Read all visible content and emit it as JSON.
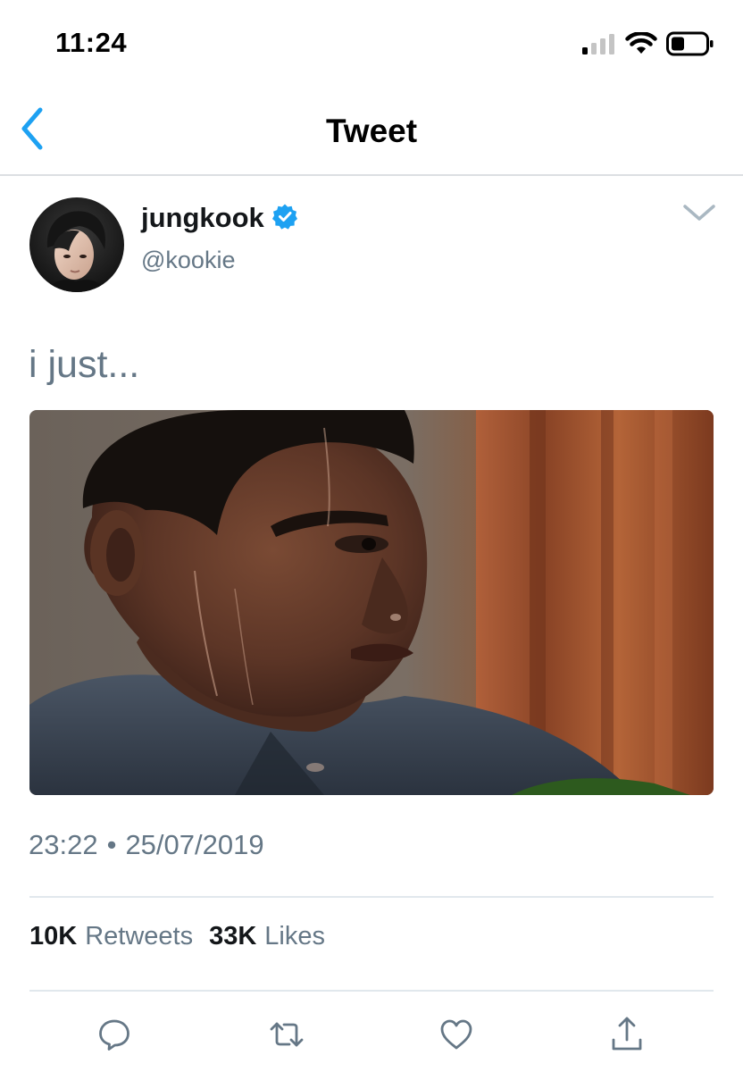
{
  "status_bar": {
    "time": "11:24",
    "signal_icon": "cellular-signal-icon",
    "wifi_icon": "wifi-icon",
    "battery_icon": "battery-icon"
  },
  "nav": {
    "back_icon": "chevron-left-icon",
    "title": "Tweet"
  },
  "tweet": {
    "author": {
      "display_name": "jungkook",
      "verified": true,
      "handle": "@kookie"
    },
    "text": "i just...",
    "media": {
      "type": "photo",
      "subject": "sweating man reaction"
    },
    "time": "23:22",
    "separator": "•",
    "date": "25/07/2019",
    "stats": {
      "retweets_count": "10K",
      "retweets_label": "Retweets",
      "likes_count": "33K",
      "likes_label": "Likes"
    }
  },
  "actions": [
    {
      "icon": "reply-icon"
    },
    {
      "icon": "retweet-icon"
    },
    {
      "icon": "like-icon"
    },
    {
      "icon": "share-icon"
    }
  ],
  "colors": {
    "accent": "#1da1f2",
    "secondary_text": "#657786",
    "primary_text": "#14171a",
    "divider": "#e1e8ed"
  }
}
